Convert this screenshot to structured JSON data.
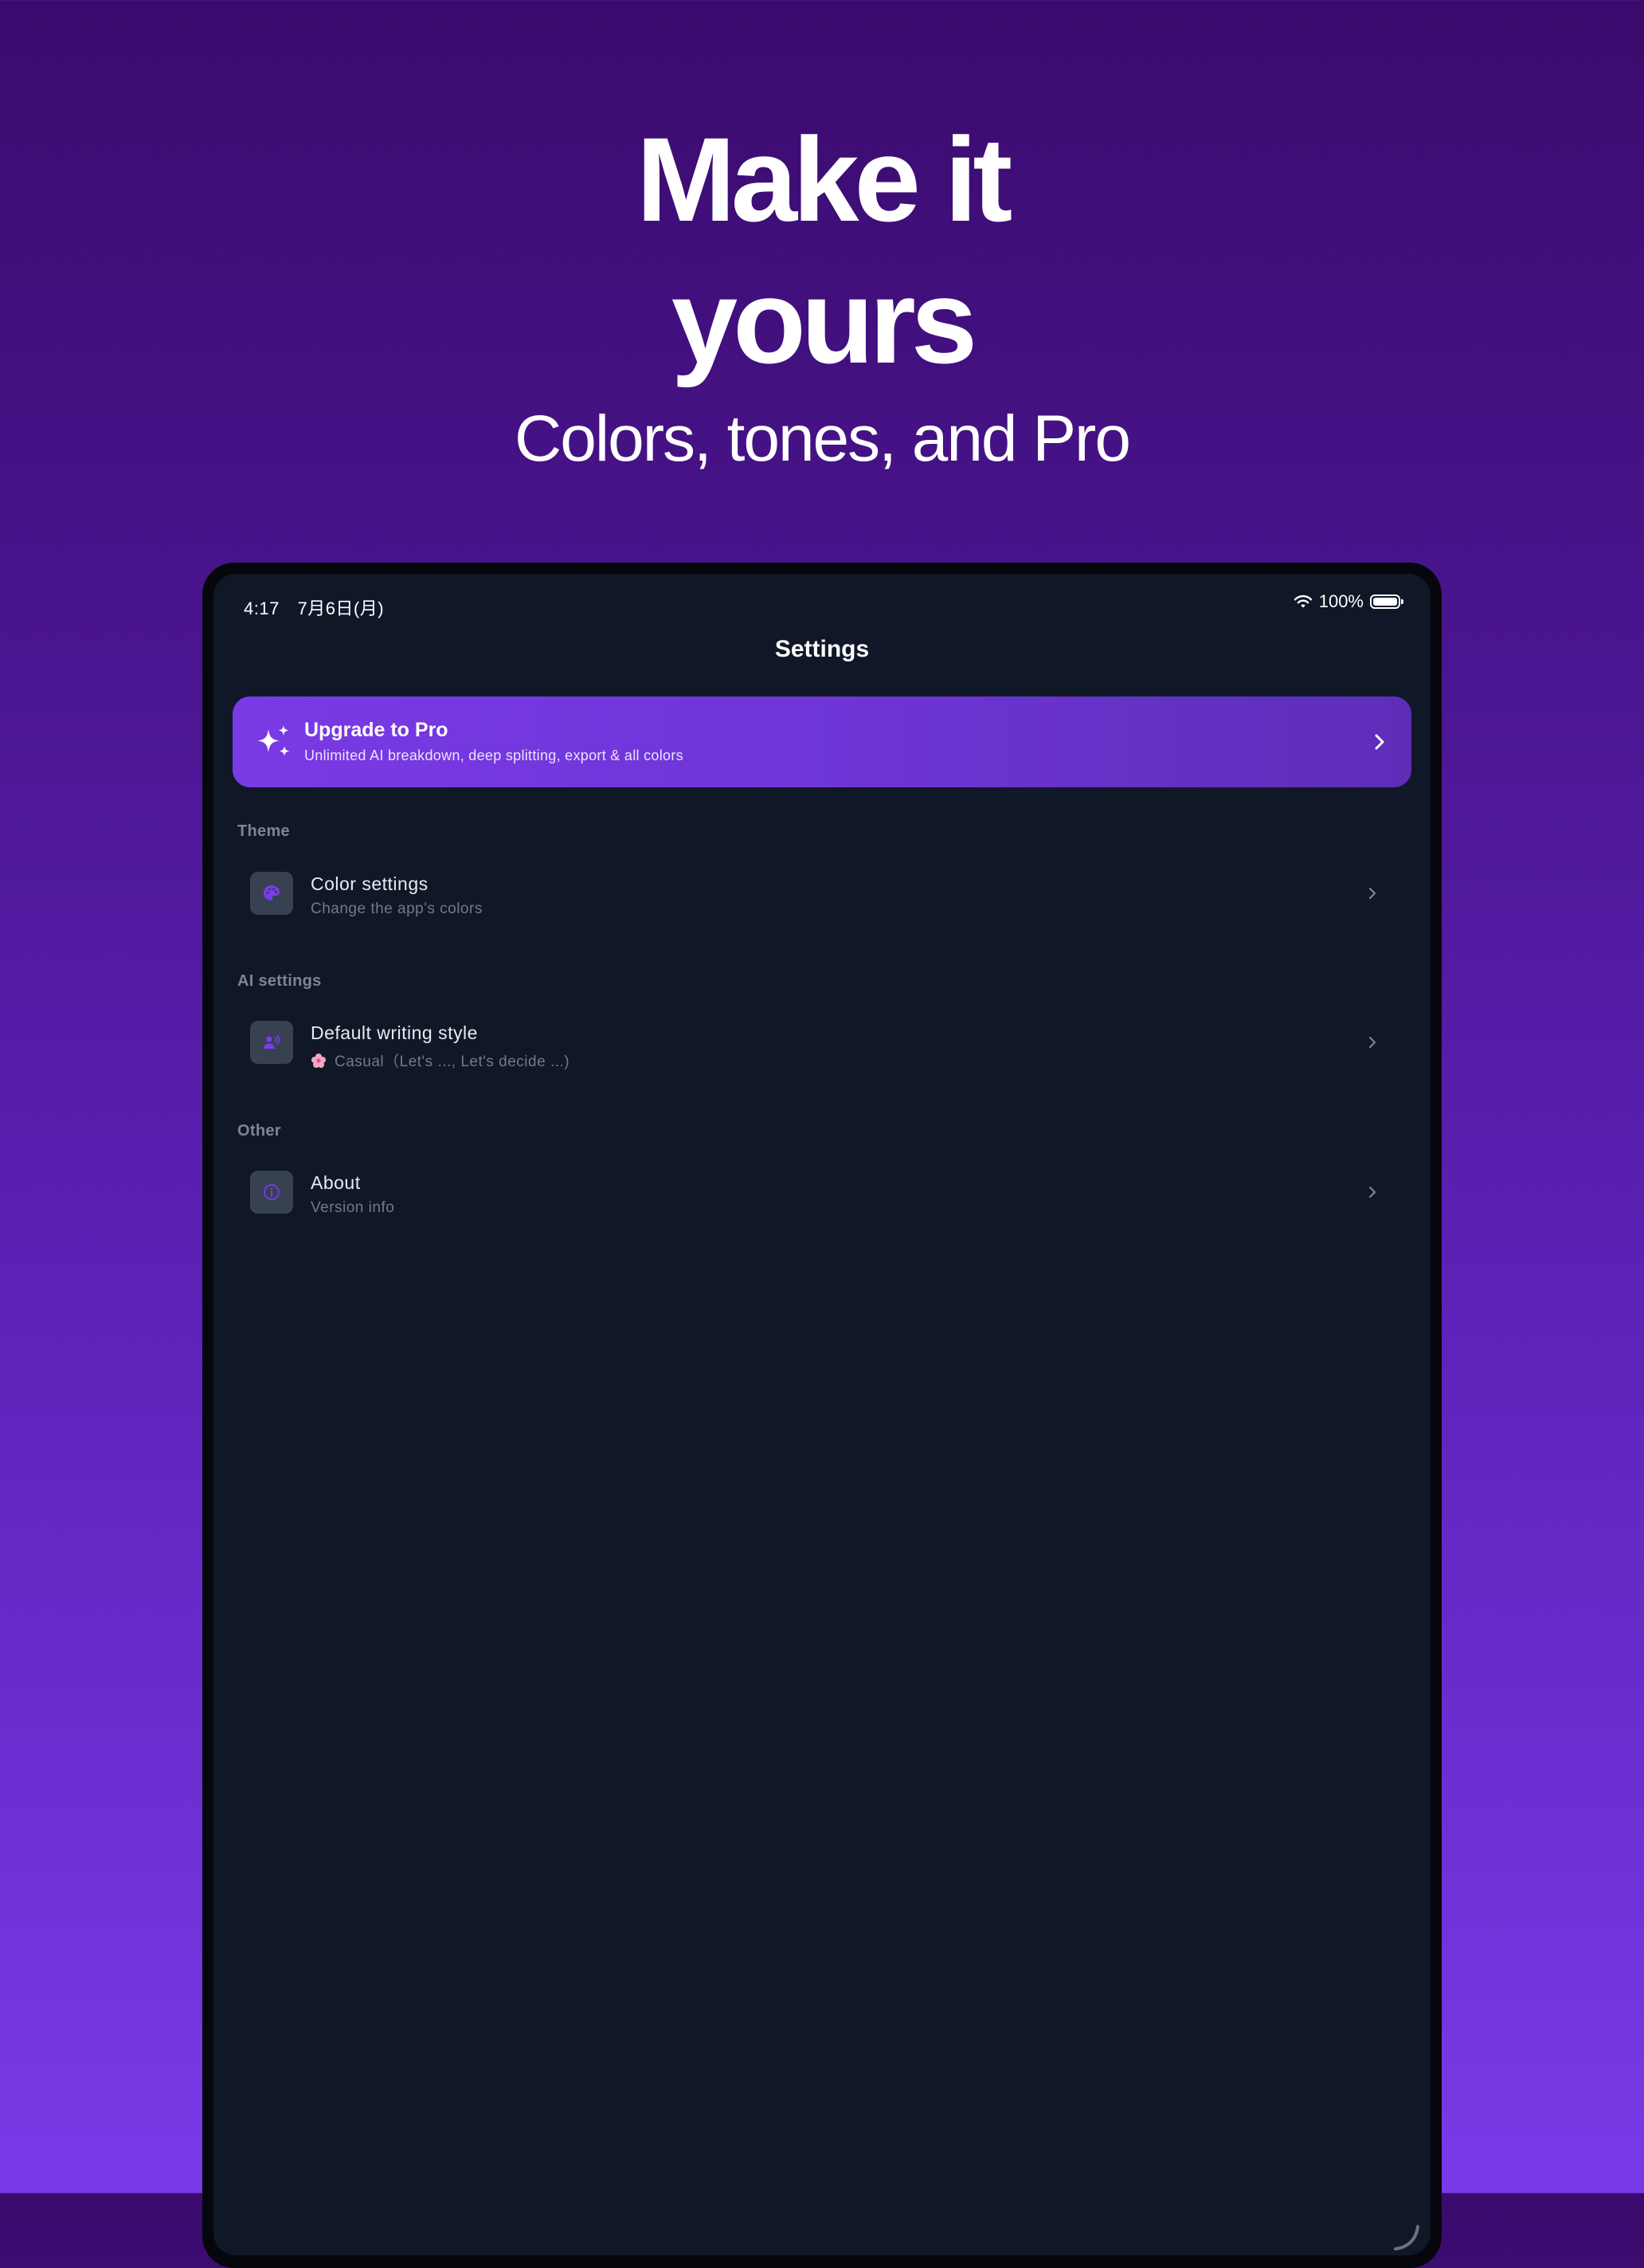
{
  "promo": {
    "headline_line1": "Make it",
    "headline_line2": "yours",
    "subheadline": "Colors, tones, and Pro"
  },
  "status_bar": {
    "time": "4:17",
    "date": "7月6日(月)",
    "battery": "100%"
  },
  "settings": {
    "title": "Settings",
    "pro_card": {
      "title": "Upgrade to Pro",
      "subtitle": "Unlimited AI breakdown, deep splitting, export & all colors"
    },
    "sections": [
      {
        "label": "Theme",
        "item": {
          "title": "Color settings",
          "subtitle": "Change the app's colors",
          "icon": "palette-icon"
        }
      },
      {
        "label": "AI settings",
        "item": {
          "title": "Default writing style",
          "subtitle": "Casual（Let's ..., Let's decide ...)",
          "icon": "speaking-person-icon"
        }
      },
      {
        "label": "Other",
        "item": {
          "title": "About",
          "subtitle": "Version info",
          "icon": "info-icon"
        }
      }
    ]
  },
  "colors": {
    "accent": "#7a3ae6",
    "screen_background": "#101828",
    "icon_tile": "#374151"
  }
}
